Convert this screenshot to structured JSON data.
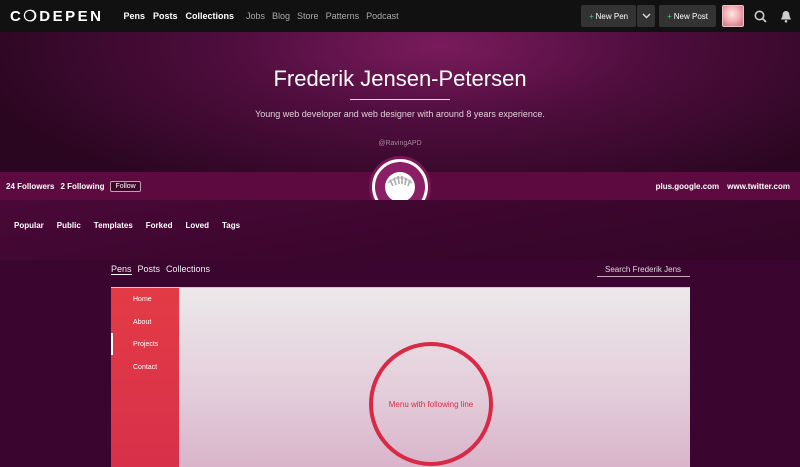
{
  "nav": {
    "logo": "C❍DEPEN",
    "main": [
      "Pens",
      "Posts",
      "Collections"
    ],
    "sub": [
      "Jobs",
      "Blog",
      "Store",
      "Patterns",
      "Podcast"
    ],
    "new_pen": "New Pen",
    "new_post": "New Post"
  },
  "profile": {
    "name": "Frederik Jensen-Petersen",
    "bio": "Young web developer and web designer with around 8 years experience.",
    "handle": "@RavingAPD",
    "followers": "24 Followers",
    "following": "2 Following",
    "follow_label": "Follow",
    "links": [
      "plus.google.com",
      "www.twitter.com"
    ]
  },
  "tabs": [
    "Popular",
    "Public",
    "Templates",
    "Forked",
    "Loved",
    "Tags"
  ],
  "subnav": {
    "items": [
      "Pens",
      "Posts",
      "Collections"
    ],
    "search_placeholder": "Search Frederik Jens"
  },
  "preview": {
    "menu": [
      "Home",
      "About",
      "Projects",
      "Contact"
    ],
    "circle_text": "Menu with following line"
  },
  "colors": {
    "accent_green": "#47cf73",
    "preview_red": "#d82a45"
  }
}
